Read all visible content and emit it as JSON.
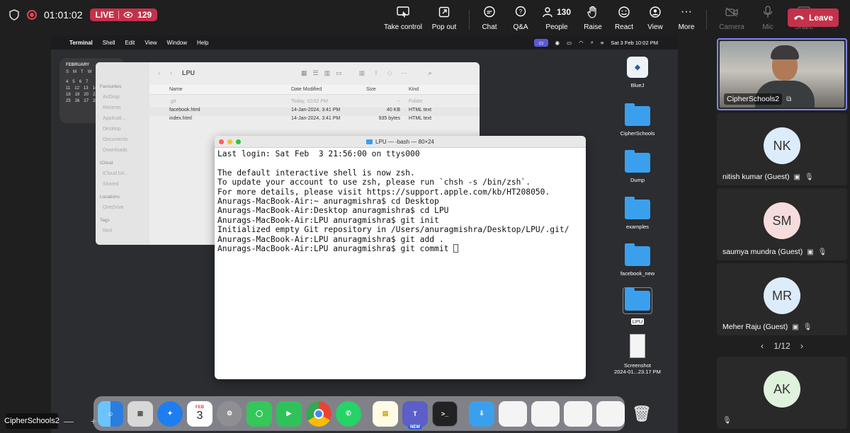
{
  "teams": {
    "timer": "01:01:02",
    "live_label": "LIVE",
    "viewer_count": "129",
    "actions": {
      "take_control": "Take control",
      "pop_out": "Pop out",
      "chat": "Chat",
      "qa": "Q&A",
      "people_count": "130",
      "people": "People",
      "raise": "Raise",
      "react": "React",
      "view": "View",
      "more": "More",
      "camera": "Camera",
      "mic": "Mic",
      "share": "Share",
      "leave": "Leave"
    },
    "presenter_name": "CipherSchools2",
    "zoom_minus": "—",
    "zoom_plus": "+"
  },
  "mac": {
    "menu": [
      "Terminal",
      "Shell",
      "Edit",
      "View",
      "Window",
      "Help"
    ],
    "datetime": "Sat 3 Feb  10:02 PM"
  },
  "calendar": {
    "month": "FEBRUARY",
    "days_header": [
      "S",
      "M",
      "T",
      "W"
    ],
    "rows": [
      [
        "4",
        "5",
        "6",
        "7"
      ],
      [
        "11",
        "12",
        "13",
        "14"
      ],
      [
        "18",
        "19",
        "20",
        "21"
      ],
      [
        "25",
        "26",
        "27",
        "28"
      ]
    ]
  },
  "finder": {
    "title": "LPU",
    "sidebar": {
      "favourites_label": "Favourites",
      "favourites": [
        "AirDrop",
        "Recents",
        "Applicati...",
        "Desktop",
        "Documents",
        "Downloads"
      ],
      "icloud_label": "iCloud",
      "icloud": [
        "iCloud Dri...",
        "Shared"
      ],
      "locations_label": "Locations",
      "locations": [
        "OneDrive"
      ],
      "tags_label": "Tags",
      "tags": [
        "Red"
      ]
    },
    "columns": {
      "name": "Name",
      "date": "Date Modified",
      "size": "Size",
      "kind": "Kind"
    },
    "rows": [
      {
        "name": ".git",
        "date": "Today, 10:02 PM",
        "size": "--",
        "kind": "Folder"
      },
      {
        "name": "facebook.html",
        "date": "14-Jan-2024, 3:41 PM",
        "size": "40 KB",
        "kind": "HTML text"
      },
      {
        "name": "index.html",
        "date": "14-Jan-2024, 3:41 PM",
        "size": "935 bytes",
        "kind": "HTML text"
      }
    ]
  },
  "terminal": {
    "title": "LPU — -bash — 80×24",
    "lines": [
      "Last login: Sat Feb  3 21:56:00 on ttys000",
      "",
      "The default interactive shell is now zsh.",
      "To update your account to use zsh, please run `chsh -s /bin/zsh`.",
      "For more details, please visit https://support.apple.com/kb/HT208050.",
      "Anurags-MacBook-Air:~ anuragmishra$ cd Desktop",
      "Anurags-MacBook-Air:Desktop anuragmishra$ cd LPU",
      "Anurags-MacBook-Air:LPU anuragmishra$ git init",
      "Initialized empty Git repository in /Users/anuragmishra/Desktop/LPU/.git/",
      "Anurags-MacBook-Air:LPU anuragmishra$ git add .",
      "Anurags-MacBook-Air:LPU anuragmishra$ git commit "
    ]
  },
  "desktop": {
    "bluej": "BlueJ",
    "cipherschools": "CipherSchools",
    "dump": "Dump",
    "examples": "examples",
    "facebook_new": "facebook_new",
    "lpu": "LPU",
    "screenshot_line1": "Screenshot",
    "screenshot_line2": "2024-01...23.17 PM"
  },
  "dock": {
    "calendar_month": "FEB",
    "calendar_day": "3",
    "teams_badge": "NEW"
  },
  "participants": [
    {
      "name": "CipherSchools2"
    },
    {
      "initials": "NK",
      "name": "nitish kumar (Guest)"
    },
    {
      "initials": "SM",
      "name": "saumya mundra (Guest)"
    },
    {
      "initials": "MR",
      "name": "Meher Raju (Guest)"
    },
    {
      "initials": "AK",
      "name": ""
    }
  ],
  "pager": {
    "label": "1/12",
    "prev": "‹",
    "next": "›"
  },
  "colors": {
    "accent": "#7f85f5",
    "leave": "#c4314b",
    "folder": "#3aa0ee"
  }
}
